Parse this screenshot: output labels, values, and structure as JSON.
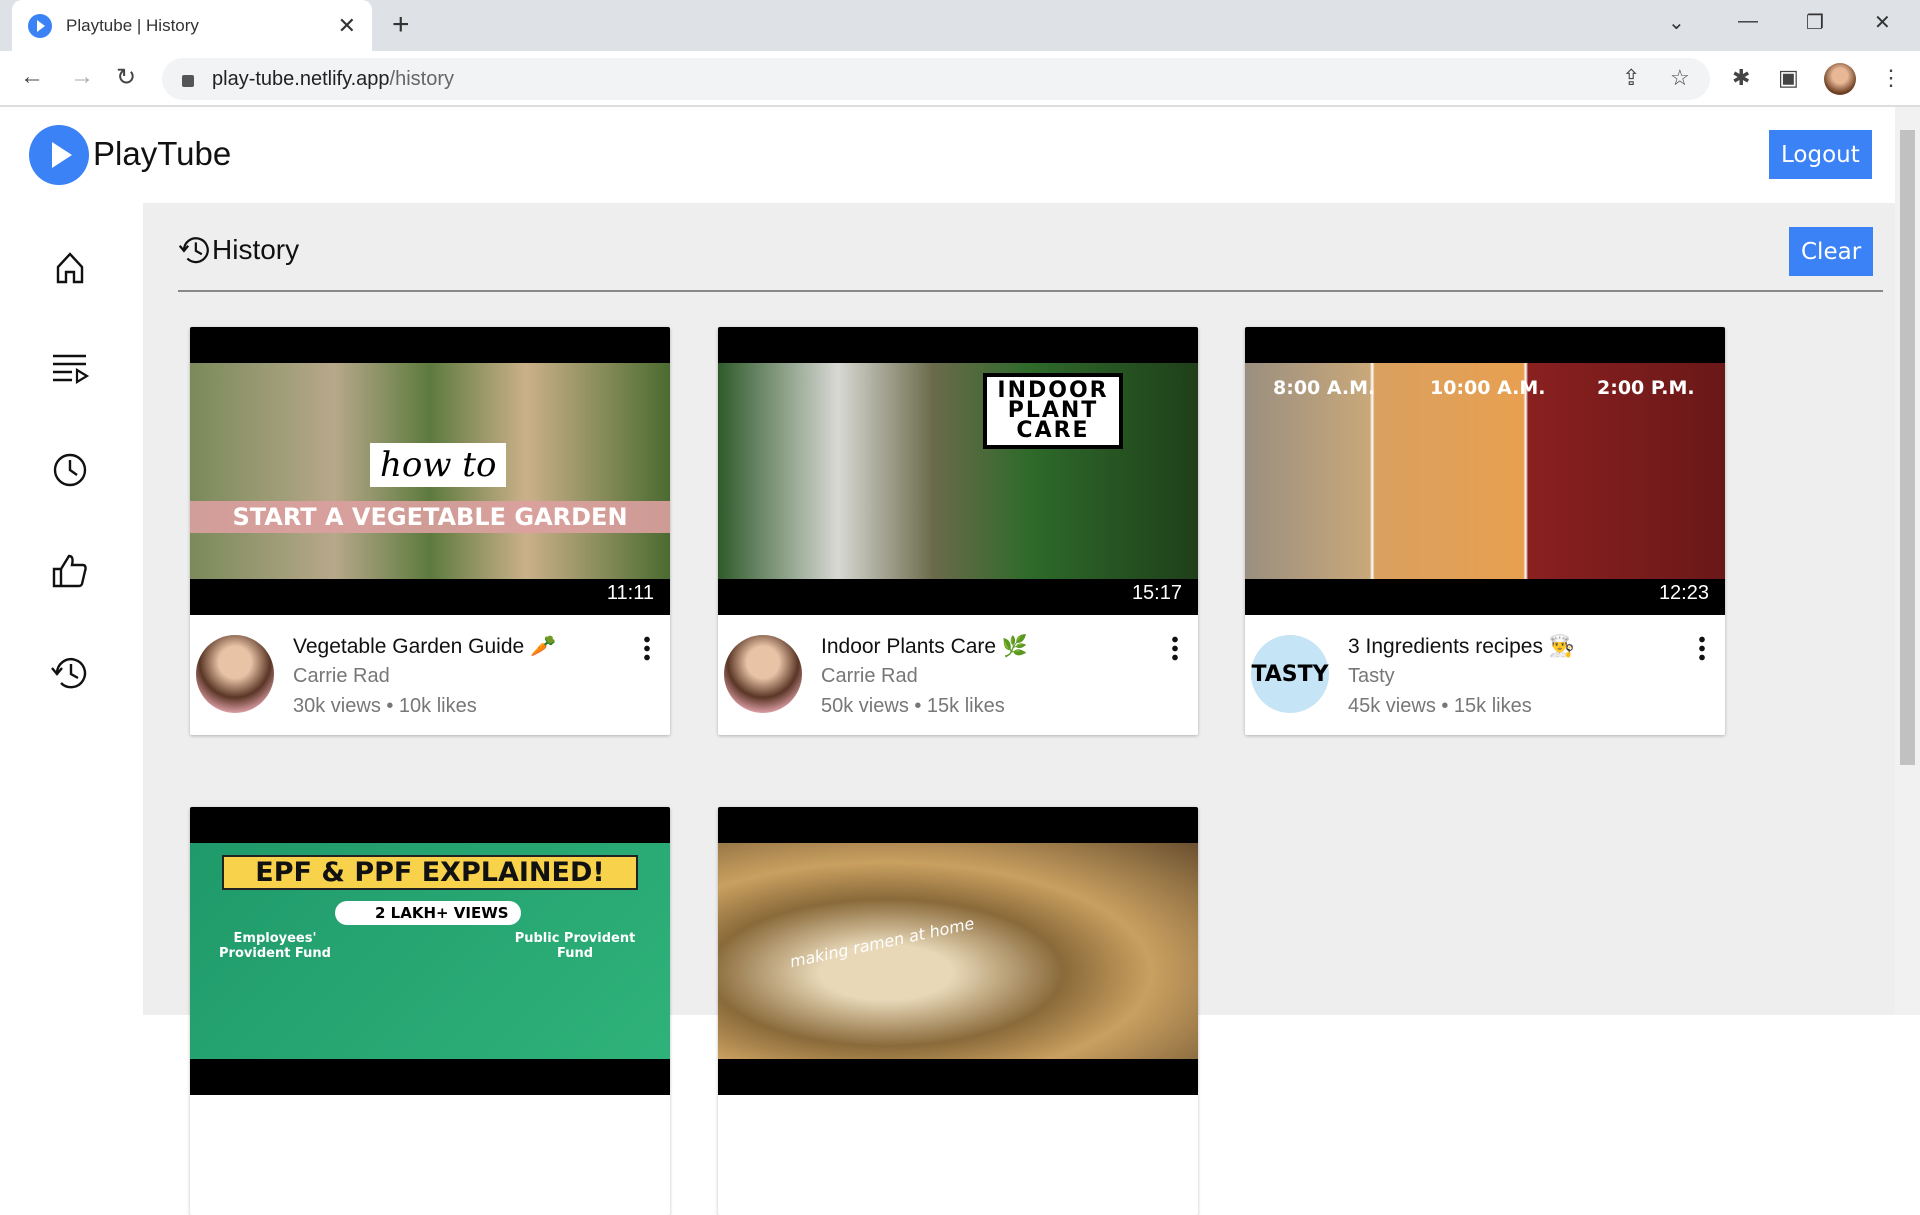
{
  "browser": {
    "tab_title": "Playtube | History",
    "url_domain": "play-tube.netlify.app",
    "url_path": "/history"
  },
  "app": {
    "brand": "PlayTube",
    "logout_label": "Logout",
    "accent": "#3b82f6"
  },
  "sidebar": {
    "items": [
      {
        "icon": "home-icon"
      },
      {
        "icon": "playlist-icon"
      },
      {
        "icon": "watch-later-icon"
      },
      {
        "icon": "liked-icon"
      },
      {
        "icon": "history-icon"
      }
    ]
  },
  "page": {
    "title": "History",
    "clear_label": "Clear"
  },
  "videos": [
    {
      "title": "Vegetable Garden Guide 🥕",
      "channel": "Carrie Rad",
      "stats": "30k views • 10k likes",
      "duration": "11:11",
      "overlay1": "how to",
      "overlay2": "START A VEGETABLE GARDEN"
    },
    {
      "title": "Indoor Plants Care 🌿",
      "channel": "Carrie Rad",
      "stats": "50k views • 15k likes",
      "duration": "15:17",
      "overlay1": "INDOOR PLANT CARE"
    },
    {
      "title": "3 Ingredients recipes 👨‍🍳",
      "channel": "Tasty",
      "stats": "45k views • 15k likes",
      "duration": "12:23",
      "times": [
        "8:00 A.M.",
        "10:00 A.M.",
        "2:00 P.M."
      ],
      "avatar_text": "TASTY"
    },
    {
      "overlay1": "EPF & PPF EXPLAINED!",
      "overlay2": "2 LAKH+ VIEWS",
      "left": "Employees' Provident Fund",
      "right": "Public Provident Fund"
    },
    {
      "overlay1": "making ramen at home"
    }
  ]
}
